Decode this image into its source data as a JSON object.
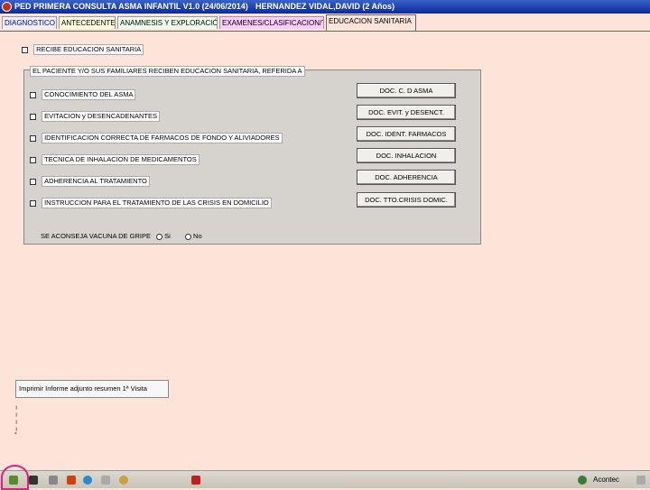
{
  "window": {
    "title": "PED PRIMERA CONSULTA ASMA INFANTIL V1.0 (24/06/2014)",
    "patient": "HERNANDEZ VIDAL,DAVID (2 Años)"
  },
  "tabs": [
    {
      "label": "DIAGNOSTICO"
    },
    {
      "label": "ANTECEDENTES"
    },
    {
      "label": "ANAMNESIS Y EXPLORACIÓN"
    },
    {
      "label": "EXAMENES/CLASIFICACION/TR"
    },
    {
      "label": "EDUCACION SANITARIA"
    }
  ],
  "receive_education": {
    "label": "RECIBE EDUCACION SANITARIA"
  },
  "education_group": {
    "title": "EL PACIENTE Y/O SUS FAMILIARES RECIBEN EDUCACION SANITARIA, REFERIDA A",
    "items": [
      {
        "label": "CONOCIMIENTO DEL ASMA",
        "button": "DOC. C. D ASMA"
      },
      {
        "label": "EVITACION y DESENCADENANTES",
        "button": "DOC. EVIT. y DESENCT."
      },
      {
        "label": "IDENTIFICACION CORRECTA DE FARMACOS DE FONDO Y ALIVIADORES",
        "button": "DOC. IDENT. FARMACOS"
      },
      {
        "label": "TECNICA DE INHALACION DE MEDICAMENTOS",
        "button": "DOC. INHALACION"
      },
      {
        "label": "ADHERENCIA AL TRATAMIENTO",
        "button": "DOC. ADHERENCIA"
      },
      {
        "label": "INSTRUCCION PARA EL TRATAMIENTO DE LAS CRISIS EN DOMICILIO",
        "button": "DOC. TTO.CRISIS DOMIC."
      }
    ]
  },
  "flu_vaccine": {
    "question": "SE ACONSEJA VACUNA DE GRIPE",
    "yes": "Si",
    "no": "No"
  },
  "print_report": {
    "label": "Imprimir Informe adjunto resumen 1ª Visita"
  },
  "taskbar": {
    "tray_text": "Acontec"
  }
}
